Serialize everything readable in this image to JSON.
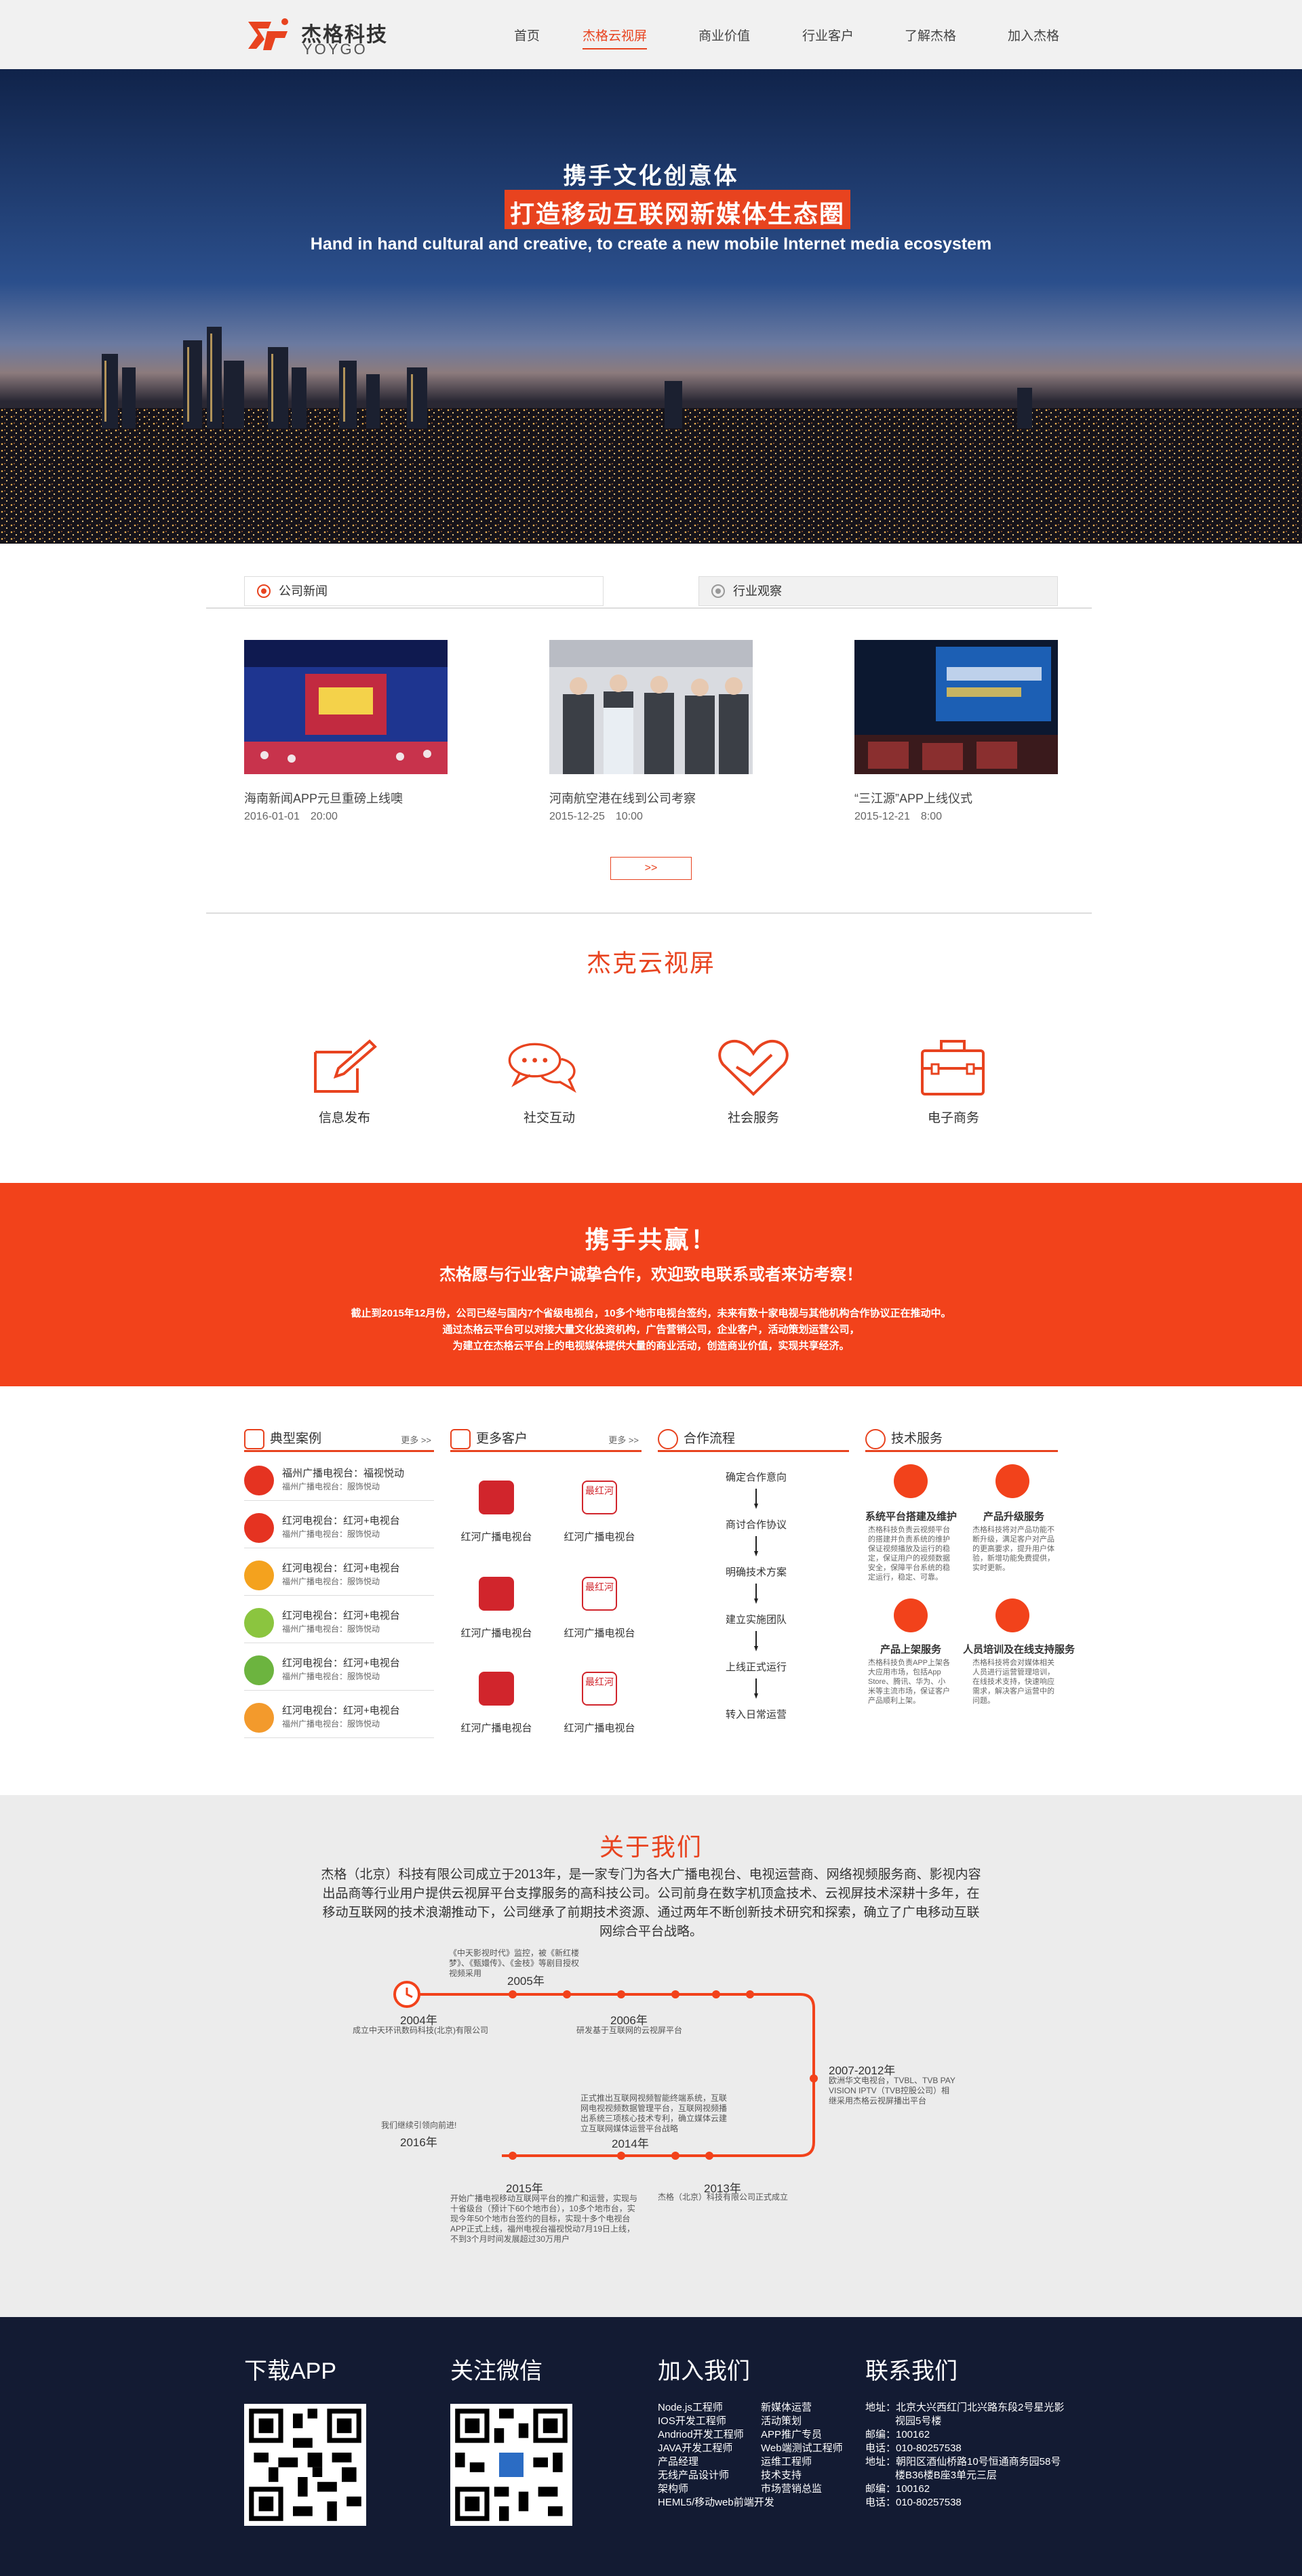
{
  "header": {
    "brand_cn": "杰格科技",
    "brand_en": "YOYGO",
    "nav": [
      "首页",
      "杰格云视屏",
      "商业价值",
      "行业客户",
      "了解杰格",
      "加入杰格"
    ],
    "active_index": 1
  },
  "hero": {
    "line1": "携手文化创意体",
    "line2": "打造移动互联网新媒体生态圈",
    "line3": "Hand in hand cultural and creative, to create a new mobile Internet media ecosystem"
  },
  "news": {
    "tabs": [
      "公司新闻",
      "行业观察"
    ],
    "items": [
      {
        "title": "海南新闻APP元旦重磅上线噢",
        "date": "2016-01-01　20:00"
      },
      {
        "title": "河南航空港在线到公司考察",
        "date": "2015-12-25　10:00"
      },
      {
        "title": "“三江源”APP上线仪式",
        "date": "2015-12-21　8:00"
      }
    ],
    "more": ">>"
  },
  "services": {
    "title": "杰克云视屏",
    "items": [
      {
        "label": "信息发布",
        "icon": "edit-icon"
      },
      {
        "label": "社交互动",
        "icon": "chat-icon"
      },
      {
        "label": "社会服务",
        "icon": "heart-icon"
      },
      {
        "label": "电子商务",
        "icon": "briefcase-icon"
      }
    ]
  },
  "band": {
    "title": "携手共赢！",
    "subtitle": "杰格愿与行业客户诚挚合作，欢迎致电联系或者来访考察！",
    "lines": [
      "截止到2015年12月份，公司已经与国内7个省级电视台，10多个地市电视台签约，未来有数十家电视与其他机构合作协议正在推动中。",
      "通过杰格云平台可以对接大量文化投资机构，广告营销公司，企业客户，活动策划运营公司，",
      "为建立在杰格云平台上的电视媒体提供大量的商业活动，创造商业价值，实现共享经济。"
    ]
  },
  "cases": {
    "title": "典型案例",
    "more": "更多 >>",
    "rows": [
      {
        "name": "福州广播电视台：福视悦动",
        "sub": "福州广播电视台：服饰悦动"
      },
      {
        "name": "红河电视台：红河+电视台",
        "sub": "福州广播电视台：服饰悦动"
      },
      {
        "name": "红河电视台：红河+电视台",
        "sub": "福州广播电视台：服饰悦动"
      },
      {
        "name": "红河电视台：红河+电视台",
        "sub": "福州广播电视台：服饰悦动"
      },
      {
        "name": "红河电视台：红河+电视台",
        "sub": "福州广播电视台：服饰悦动"
      },
      {
        "name": "红河电视台：红河+电视台",
        "sub": "福州广播电视台：服饰悦动"
      }
    ]
  },
  "customers": {
    "title": "更多客户",
    "more": "更多 >>",
    "items": [
      "红河广播电视台",
      "红河广播电视台",
      "红河广播电视台",
      "红河广播电视台",
      "红河广播电视台",
      "红河广播电视台"
    ],
    "logo_text": "最红河"
  },
  "flow": {
    "title": "合作流程",
    "steps": [
      "确定合作意向",
      "商讨合作协议",
      "明确技术方案",
      "建立实施团队",
      "上线正式运行",
      "转入日常运营"
    ]
  },
  "tech": {
    "title": "技术服务",
    "items": [
      {
        "title": "系统平台搭建及维护",
        "desc": "杰格科技负责云视频平台的搭建并负责系统的维护保证视频播放及运行的稳定，保证用户的视频数据安全，保障平台系统的稳定运行，稳定、可靠。"
      },
      {
        "title": "产品升级服务",
        "desc": "杰格科技将对产品功能不断升级，满足客户对产品的更高要求，提升用户体验，新增功能免费提供，实时更新。"
      },
      {
        "title": "产品上架服务",
        "desc": "杰格科技负责APP上架各大应用市场，包括App Store、腾讯、华为、小米等主流市场，保证客户产品顺利上架。"
      },
      {
        "title": "人员培训及在线支持服务",
        "desc": "杰格科技将会对媒体相关人员进行运营管理培训，在线技术支持，快速响应需求，解决客户运营中的问题。"
      }
    ]
  },
  "about": {
    "title": "关于我们",
    "paragraph": "杰格（北京）科技有限公司成立于2013年，是一家专门为各大广播电视台、电视运营商、网络视频服务商、影视内容出品商等行业用户提供云视屏平台支撑服务的高科技公司。公司前身在数字机顶盒技术、云视屏技术深耕十多年，在移动互联网的技术浪潮推动下，公司继承了前期技术资源、通过两年不断创新技术研究和探索，确立了广电移动互联网综合平台战略。",
    "timeline": [
      {
        "year": "2004年",
        "note": "成立中天环讯数码科技(北京)有限公司"
      },
      {
        "year": "2005年",
        "note": "《中天影视时代》监控，被《新红楼梦》、《甄嬛传》、《金枝》等剧目授权视频采用"
      },
      {
        "year": "2006年",
        "note": "研发基于互联网的云视屏平台"
      },
      {
        "year": "2007-2012年",
        "note": "欧洲华文电视台，TVBL、TVB PAY VISION IPTV（TVB控股公司）相继采用杰格云视屏播出平台"
      },
      {
        "year": "2013年",
        "note": "杰格（北京）科技有限公司正式成立"
      },
      {
        "year": "2014年",
        "note": "正式推出互联网视频智能终端系统，互联网电视视频数据管理平台，互联网视频播出系统三项核心技术专利，确立媒体云建立互联网媒体运营平台战略"
      },
      {
        "year": "2015年",
        "note": "开始广播电视移动互联网平台的推广和运营，实现与十省级台（预计下60个地市台），10多个地市台，实现今年50个地市台签约的目标，实现十多个电视台APP正式上线，福州电视台福视悦动7月19日上线，不到3个月时间发展超过30万用户"
      },
      {
        "year": "2016年",
        "note": "我们继续引领向前进!"
      }
    ]
  },
  "footer": {
    "download": "下载APP",
    "wechat": "关注微信",
    "join": "加入我们",
    "contact": "联系我们",
    "jobs_left": [
      "Node.js工程师",
      "IOS开发工程师",
      "Andriod开发工程师",
      "JAVA开发工程师",
      "产品经理",
      "无线产品设计师",
      "架构师",
      "HEML5/移动web前端开发"
    ],
    "jobs_right": [
      "新媒体运营",
      "活动策划",
      "APP推广专员",
      "Web端测试工程师",
      "运维工程师",
      "技术支持",
      "市场营销总监"
    ],
    "contacts": [
      "地址：北京大兴西红门北兴路东段2号星光影",
      "视园5号楼",
      "邮编：100162",
      "电话：010-80257538",
      "地址：朝阳区酒仙桥路10号恒通商务园58号",
      "楼B36楼B座3单元三层",
      "邮编：100162",
      "电话：010-80257538"
    ]
  },
  "colors": {
    "accent": "#e8431f",
    "band": "#f2421b",
    "footer": "#131b33"
  }
}
